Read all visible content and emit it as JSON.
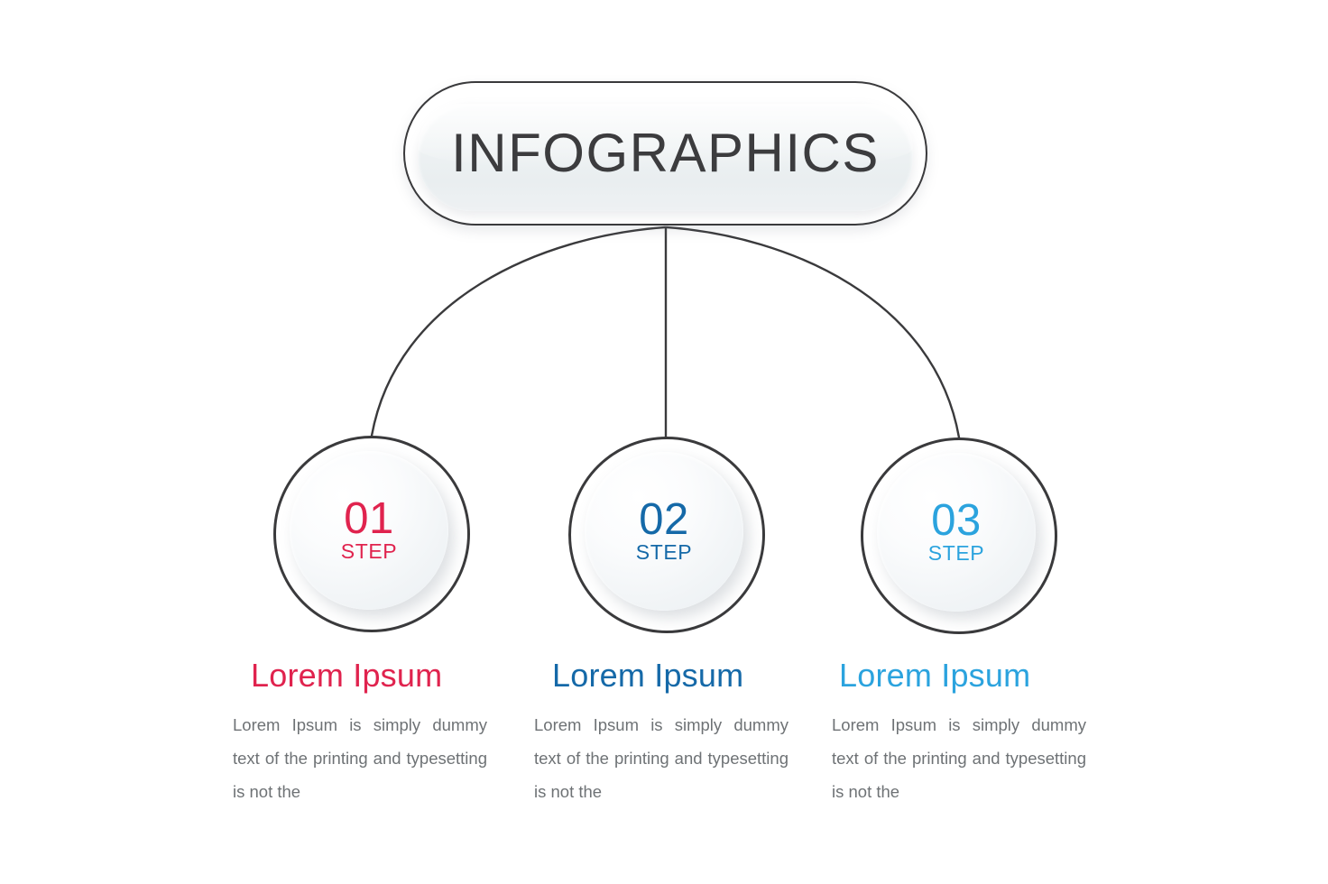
{
  "page": {
    "background_color": "#ffffff",
    "title_badge": {
      "label": "INFOGRAPHICS",
      "text_color": "#3c3c3e",
      "border_color": "#3a3a3c",
      "panel_color": "#eef1f3"
    }
  },
  "connector": {
    "line_color": "#3a3a3c",
    "style": "fan-arcs"
  },
  "steps": [
    {
      "number": "01",
      "step_word": "STEP",
      "accent_color": "#e0234e",
      "heading": "Lorem Ipsum",
      "body": "Lorem Ipsum is simply dummy text of the printing and typesetting is not the"
    },
    {
      "number": "02",
      "step_word": "STEP",
      "accent_color": "#1569a8",
      "heading": "Lorem Ipsum",
      "body": "Lorem Ipsum is simply dummy text of the printing and typesetting is not the"
    },
    {
      "number": "03",
      "step_word": "STEP",
      "accent_color": "#2ba3de",
      "heading": "Lorem Ipsum",
      "body": "Lorem Ipsum is simply dummy text of the printing and typesetting is not the"
    }
  ]
}
